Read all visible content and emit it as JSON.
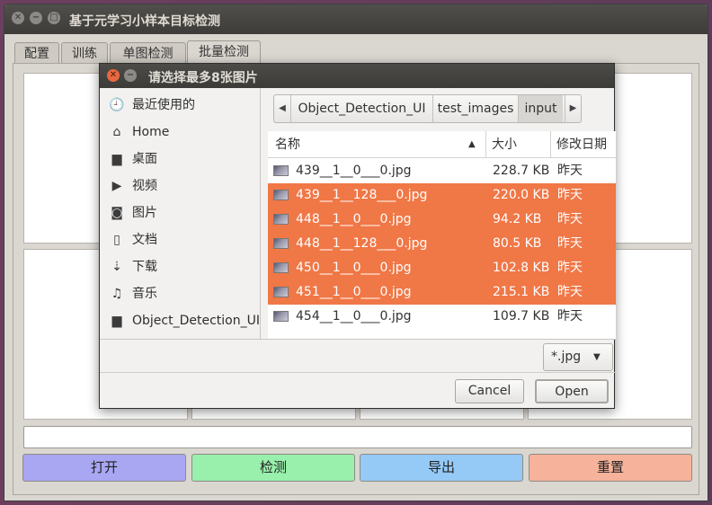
{
  "main_window": {
    "title": "基于元学习小样本目标检测",
    "tabs": [
      "配置",
      "训练",
      "单图检测",
      "批量检测"
    ],
    "actions": [
      {
        "label": "打开",
        "color": "#a9a6f2"
      },
      {
        "label": "检测",
        "color": "#99f0ac"
      },
      {
        "label": "导出",
        "color": "#95caf7"
      },
      {
        "label": "重置",
        "color": "#f6b29a"
      }
    ]
  },
  "dialog": {
    "title": "请选择最多8张图片",
    "sidebar": [
      {
        "icon": "recent-icon",
        "glyph": "🕘",
        "label": "最近使用的"
      },
      {
        "icon": "home-icon",
        "glyph": "⌂",
        "label": "Home"
      },
      {
        "icon": "desktop-folder-icon",
        "glyph": "▆",
        "label": "桌面"
      },
      {
        "icon": "video-icon",
        "glyph": "▶",
        "label": "视频"
      },
      {
        "icon": "camera-icon",
        "glyph": "◙",
        "label": "图片"
      },
      {
        "icon": "document-icon",
        "glyph": "▯",
        "label": "文档"
      },
      {
        "icon": "download-icon",
        "glyph": "⇣",
        "label": "下载"
      },
      {
        "icon": "music-icon",
        "glyph": "♫",
        "label": "音乐"
      },
      {
        "icon": "folder-icon",
        "glyph": "▆",
        "label": "Object_Detection_UI"
      }
    ],
    "breadcrumbs": [
      "Object_Detection_UI",
      "test_images",
      "input"
    ],
    "columns": {
      "name": "名称",
      "size": "大小",
      "modified": "修改日期"
    },
    "files": [
      {
        "name": "439__1__0___0.jpg",
        "size": "228.7 KB",
        "date": "昨天",
        "selected": false
      },
      {
        "name": "439__1__128___0.jpg",
        "size": "220.0 KB",
        "date": "昨天",
        "selected": true
      },
      {
        "name": "448__1__0___0.jpg",
        "size": "94.2 KB",
        "date": "昨天",
        "selected": true
      },
      {
        "name": "448__1__128___0.jpg",
        "size": "80.5 KB",
        "date": "昨天",
        "selected": true
      },
      {
        "name": "450__1__0___0.jpg",
        "size": "102.8 KB",
        "date": "昨天",
        "selected": true
      },
      {
        "name": "451__1__0___0.jpg",
        "size": "215.1 KB",
        "date": "昨天",
        "selected": true
      },
      {
        "name": "454__1__0___0.jpg",
        "size": "109.7 KB",
        "date": "昨天",
        "selected": false
      }
    ],
    "filter": "*.jpg",
    "cancel_label": "Cancel",
    "open_label": "Open"
  }
}
